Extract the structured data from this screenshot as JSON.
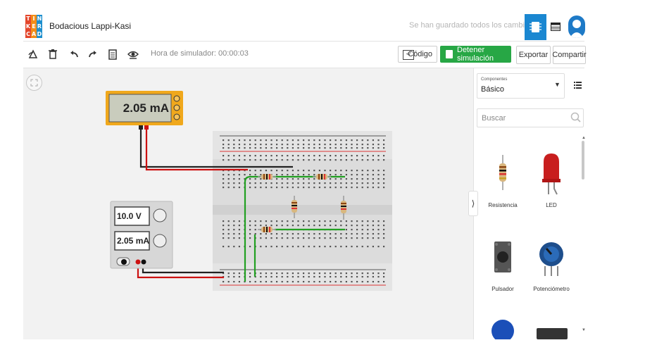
{
  "header": {
    "logo_letters": [
      "T",
      "I",
      "N",
      "K",
      "E",
      "R",
      "C",
      "A",
      "D"
    ],
    "logo_colors": [
      "#e4462b",
      "#f28c18",
      "#1e8fce",
      "#e4462b",
      "#f28c18",
      "#1e8fce",
      "#e4462b",
      "#f28c18",
      "#1e8fce"
    ],
    "title": "Bodacious Lappi-Kasi",
    "save_status": "Se han guardado todos los cambios.",
    "accent_color": "#1a87d1"
  },
  "toolbar": {
    "tools": [
      "rotate-icon",
      "delete-icon",
      "undo-icon",
      "redo-icon",
      "notes-icon",
      "visibility-icon"
    ],
    "sim_time": "Hora de simulador: 00:00:03",
    "code_label": "Código",
    "stop_label": "Detener simulación",
    "export_label": "Exportar",
    "share_label": "Compartir",
    "stop_color": "#27a745"
  },
  "multimeter": {
    "reading": "2.05 mA"
  },
  "power_supply": {
    "voltage": "10.0 V",
    "current": "2.05 mA"
  },
  "panel": {
    "dropdown_caption": "Componentes",
    "dropdown_value": "Básico",
    "search_placeholder": "Buscar",
    "components": [
      {
        "label": "Resistencia",
        "icon": "resistor-icon"
      },
      {
        "label": "LED",
        "icon": "led-icon"
      },
      {
        "label": "Pulsador",
        "icon": "pushbutton-icon"
      },
      {
        "label": "Potenciómetro",
        "icon": "potentiometer-icon"
      }
    ]
  }
}
